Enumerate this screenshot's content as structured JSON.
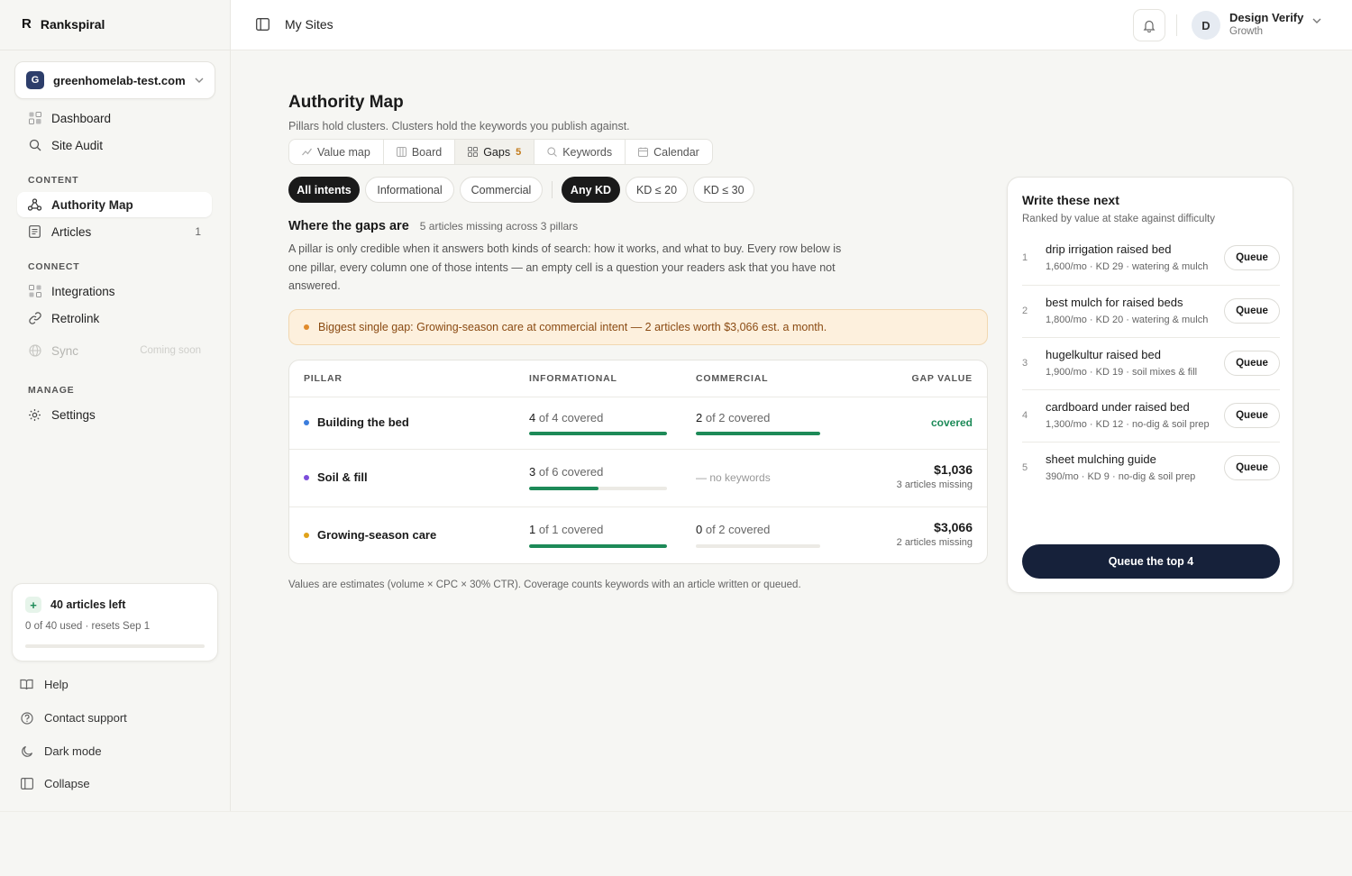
{
  "brand": {
    "mark": "R",
    "name": "Rankspiral"
  },
  "site_picker": {
    "initial": "G",
    "domain": "greenhomelab-test.com"
  },
  "nav": {
    "dashboard": "Dashboard",
    "site_audit": "Site Audit",
    "content_label": "CONTENT",
    "authority_map": "Authority Map",
    "articles": "Articles",
    "articles_count": "1",
    "connect_label": "CONNECT",
    "integrations": "Integrations",
    "retrolink": "Retrolink",
    "sync": "Sync",
    "sync_badge": "Coming soon",
    "manage_label": "MANAGE",
    "settings": "Settings"
  },
  "usage": {
    "title": "40 articles left",
    "sub": "0 of 40 used · resets Sep 1",
    "fraction": 0
  },
  "footer": {
    "help": "Help",
    "support": "Contact support",
    "dark_mode": "Dark mode",
    "collapse": "Collapse"
  },
  "topbar": {
    "breadcrumb": "My Sites",
    "user_initial": "D",
    "user_name": "Design Verify",
    "user_plan": "Growth"
  },
  "page": {
    "title": "Authority Map",
    "subtitle": "Pillars hold clusters. Clusters hold the keywords you publish against."
  },
  "tabs": [
    {
      "label": "Value map",
      "icon": "trend-icon"
    },
    {
      "label": "Board",
      "icon": "board-icon"
    },
    {
      "label": "Gaps",
      "icon": "grid-icon",
      "badge": "5"
    },
    {
      "label": "Keywords",
      "icon": "search-icon"
    },
    {
      "label": "Calendar",
      "icon": "calendar-icon"
    }
  ],
  "filters": {
    "all_intents": "All intents",
    "informational": "Informational",
    "commercial": "Commercial",
    "any_kd": "Any KD",
    "kd20": "KD ≤ 20",
    "kd30": "KD ≤ 30"
  },
  "gaps": {
    "heading": "Where the gaps are",
    "meta": "5 articles missing across 3 pillars",
    "description": "A pillar is only credible when it answers both kinds of search: how it works, and what to buy. Every row below is one pillar, every column one of those intents — an empty cell is a question your readers ask that you have not answered.",
    "alert": "Biggest single gap: Growing-season care at commercial intent — 2 articles worth $3,066 est. a month."
  },
  "table": {
    "headers": {
      "pillar": "PILLAR",
      "informational": "INFORMATIONAL",
      "commercial": "COMMERCIAL",
      "gap_value": "GAP VALUE"
    },
    "rows": [
      {
        "pillar": "Building the bed",
        "dot_color": "#3b7ddd",
        "info_num": "4",
        "info_rest": " of 4 covered",
        "info_fraction": 1,
        "com_num": "2",
        "com_rest": " of 2 covered",
        "com_fraction": 1,
        "com_empty": "",
        "gap_amount": "",
        "gap_missing": "",
        "gap_status": "covered"
      },
      {
        "pillar": "Soil & fill",
        "dot_color": "#7c4ddb",
        "info_num": "3",
        "info_rest": " of 6 covered",
        "info_fraction": 0.5,
        "com_num": "",
        "com_rest": "",
        "com_fraction": null,
        "com_empty": "— no keywords",
        "gap_amount": "$1,036",
        "gap_missing": "3 articles missing",
        "gap_status": ""
      },
      {
        "pillar": "Growing-season care",
        "dot_color": "#e0a21a",
        "info_num": "1",
        "info_rest": " of 1 covered",
        "info_fraction": 1,
        "com_num": "0",
        "com_rest": " of 2 covered",
        "com_fraction": 0,
        "com_empty": "",
        "gap_amount": "$3,066",
        "gap_missing": "2 articles missing",
        "gap_status": ""
      }
    ]
  },
  "footnote": "Values are estimates (volume × CPC × 30% CTR). Coverage counts keywords with an article written or queued.",
  "next": {
    "title": "Write these next",
    "subtitle": "Ranked by value at stake against difficulty",
    "items": [
      {
        "rank": "1",
        "keyword": "drip irrigation raised bed",
        "meta": "1,600/mo · KD 29 · watering & mulch",
        "action": "Queue"
      },
      {
        "rank": "2",
        "keyword": "best mulch for raised beds",
        "meta": "1,800/mo · KD 20 · watering & mulch",
        "action": "Queue"
      },
      {
        "rank": "3",
        "keyword": "hugelkultur raised bed",
        "meta": "1,900/mo · KD 19 · soil mixes & fill",
        "action": "Queue"
      },
      {
        "rank": "4",
        "keyword": "cardboard under raised bed",
        "meta": "1,300/mo · KD 12 · no-dig & soil prep",
        "action": "Queue"
      },
      {
        "rank": "5",
        "keyword": "sheet mulching guide",
        "meta": "390/mo · KD 9 · no-dig & soil prep",
        "action": "Queue"
      }
    ],
    "cta": "Queue the top 4"
  }
}
